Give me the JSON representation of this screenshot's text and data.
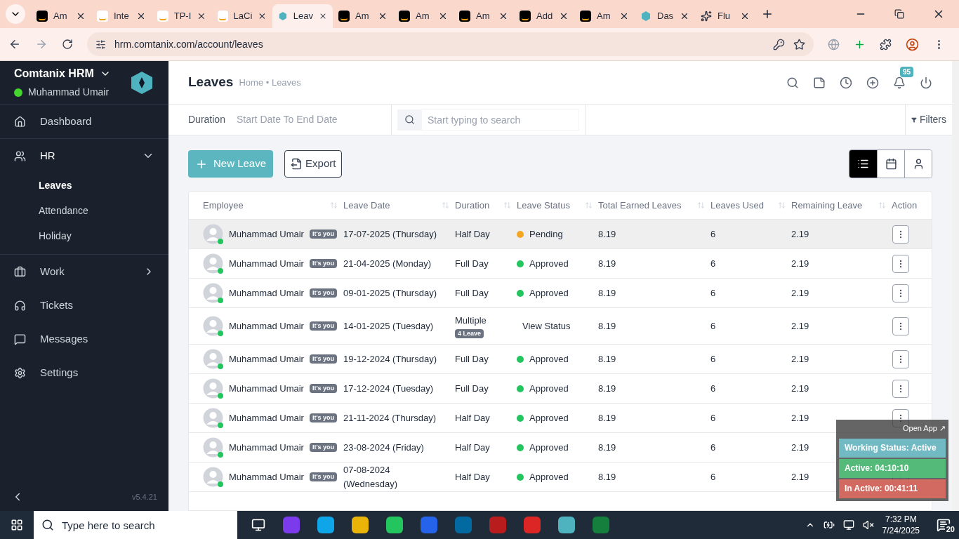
{
  "browser": {
    "tabs": [
      {
        "title": "Am",
        "kind": "amazon",
        "selected": false
      },
      {
        "title": "Inte",
        "kind": "amazon-light",
        "selected": false
      },
      {
        "title": "TP-I",
        "kind": "amazon-light",
        "selected": false
      },
      {
        "title": "LaCi",
        "kind": "amazon-light",
        "selected": false
      },
      {
        "title": "Leav",
        "kind": "hex",
        "selected": true
      },
      {
        "title": "Am",
        "kind": "amazon",
        "selected": false
      },
      {
        "title": "Am",
        "kind": "amazon",
        "selected": false
      },
      {
        "title": "Am",
        "kind": "amazon",
        "selected": false
      },
      {
        "title": "Add",
        "kind": "amazon",
        "selected": false
      },
      {
        "title": "Am",
        "kind": "amazon",
        "selected": false
      },
      {
        "title": "Das",
        "kind": "hex",
        "selected": false
      },
      {
        "title": "Flu",
        "kind": "ai",
        "selected": false
      }
    ],
    "url": "hrm.comtanix.com/account/leaves"
  },
  "sidebar": {
    "app_name": "Comtanix HRM",
    "user": "Muhammad Umair",
    "online": true,
    "version": "v5.4.21",
    "items": [
      {
        "label": "Dashboard",
        "expanded": false
      },
      {
        "label": "HR",
        "expanded": true,
        "children": [
          {
            "label": "Leaves",
            "selected": true
          },
          {
            "label": "Attendance",
            "selected": false
          },
          {
            "label": "Holiday",
            "selected": false
          }
        ]
      },
      {
        "label": "Work",
        "expanded": false
      },
      {
        "label": "Tickets",
        "expanded": false
      },
      {
        "label": "Messages",
        "expanded": false
      },
      {
        "label": "Settings",
        "expanded": false
      }
    ]
  },
  "header": {
    "title": "Leaves",
    "breadcrumb": "Home • Leaves",
    "notification_count": "95"
  },
  "filters": {
    "duration_label": "Duration",
    "duration_placeholder": "Start Date To End Date",
    "search_placeholder": "Start typing to search",
    "filters_button": "Filters"
  },
  "toolbar": {
    "new_button": "New Leave",
    "export_button": "Export",
    "views": [
      {
        "kind": "list",
        "selected": true
      },
      {
        "kind": "calendar",
        "selected": false
      },
      {
        "kind": "person",
        "selected": false
      }
    ]
  },
  "table": {
    "columns": [
      "Employee",
      "Leave Date",
      "Duration",
      "Leave Status",
      "Total Earned Leaves",
      "Leaves Used",
      "Remaining Leave",
      "Action"
    ],
    "rows": [
      {
        "employee": "Muhammad Umair",
        "badge": "It's you",
        "online": true,
        "selected": true,
        "date": "17-07-2025 (Thursday)",
        "duration": "Half Day",
        "status": "Pending",
        "kind": "dot",
        "color": "#f5a623",
        "earned": "8.19",
        "used": "6",
        "remaining": "2.19"
      },
      {
        "employee": "Muhammad Umair",
        "badge": "It's you",
        "online": true,
        "selected": false,
        "date": "21-04-2025 (Monday)",
        "duration": "Full Day",
        "status": "Approved",
        "kind": "dot",
        "color": "#22c55e",
        "earned": "8.19",
        "used": "6",
        "remaining": "2.19"
      },
      {
        "employee": "Muhammad Umair",
        "badge": "It's you",
        "online": true,
        "selected": false,
        "date": "09-01-2025 (Thursday)",
        "duration": "Full Day",
        "status": "Approved",
        "kind": "dot",
        "color": "#22c55e",
        "earned": "8.19",
        "used": "6",
        "remaining": "2.19"
      },
      {
        "employee": "Muhammad Umair",
        "badge": "It's you",
        "online": true,
        "selected": false,
        "date": "14-01-2025 (Tuesday)",
        "duration": "Multiple",
        "duration_badge": "4 Leave",
        "status": "View Status",
        "kind": "link",
        "earned": "8.19",
        "used": "6",
        "remaining": "2.19"
      },
      {
        "employee": "Muhammad Umair",
        "badge": "It's you",
        "online": true,
        "selected": false,
        "date": "19-12-2024 (Thursday)",
        "duration": "Full Day",
        "status": "Approved",
        "kind": "dot",
        "color": "#22c55e",
        "earned": "8.19",
        "used": "6",
        "remaining": "2.19"
      },
      {
        "employee": "Muhammad Umair",
        "badge": "It's you",
        "online": true,
        "selected": false,
        "date": "17-12-2024 (Tuesday)",
        "duration": "Full Day",
        "status": "Approved",
        "kind": "dot",
        "color": "#22c55e",
        "earned": "8.19",
        "used": "6",
        "remaining": "2.19"
      },
      {
        "employee": "Muhammad Umair",
        "badge": "It's you",
        "online": true,
        "selected": false,
        "date": "21-11-2024 (Thursday)",
        "duration": "Half Day",
        "status": "Approved",
        "kind": "dot",
        "color": "#22c55e",
        "earned": "8.19",
        "used": "6",
        "remaining": "2.19"
      },
      {
        "employee": "Muhammad Umair",
        "badge": "It's you",
        "online": true,
        "selected": false,
        "date": "23-08-2024 (Friday)",
        "duration": "Half Day",
        "status": "Approved",
        "kind": "dot",
        "color": "#22c55e",
        "earned": "8.19",
        "used": "6",
        "remaining": "2.19"
      },
      {
        "employee": "Muhammad Umair",
        "badge": "It's you",
        "online": true,
        "selected": false,
        "date": "07-08-2024 (Wednesday)",
        "duration": "Half Day",
        "status": "Approved",
        "kind": "dot",
        "color": "#22c55e",
        "earned": "8.19",
        "used": "6",
        "remaining": "2.19"
      }
    ]
  },
  "tracker": {
    "open_app": "Open App ↗",
    "working_status": "Working Status: Active",
    "active": "Active: 04:10:10",
    "inactive": "In Active: 00:41:11"
  },
  "taskbar": {
    "search_placeholder": "Type here to search",
    "time": "7:32 PM",
    "date": "7/24/2025",
    "notifications": "20"
  }
}
